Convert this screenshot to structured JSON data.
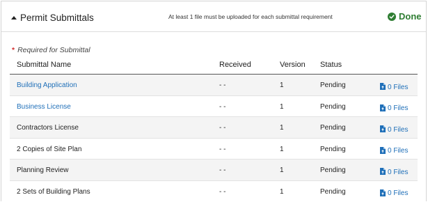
{
  "header": {
    "title": "Permit Submittals",
    "requirement_note": "At least 1 file must be uploaded for each submittal requirement",
    "status_label": "Done",
    "status_color": "#2e7d32"
  },
  "required_legend": {
    "star": "*",
    "text": "Required for Submittal"
  },
  "table": {
    "columns": [
      "Submittal Name",
      "Received",
      "Version",
      "Status"
    ],
    "rows": [
      {
        "name": "Building Application",
        "is_link": true,
        "received": "- -",
        "version": "1",
        "status": "Pending",
        "files": "0 Files"
      },
      {
        "name": "Business License",
        "is_link": true,
        "received": "- -",
        "version": "1",
        "status": "Pending",
        "files": "0 Files"
      },
      {
        "name": "Contractors License",
        "is_link": false,
        "received": "- -",
        "version": "1",
        "status": "Pending",
        "files": "0 Files"
      },
      {
        "name": "2 Copies of Site Plan",
        "is_link": false,
        "received": "- -",
        "version": "1",
        "status": "Pending",
        "files": "0 Files"
      },
      {
        "name": "Planning Review",
        "is_link": false,
        "received": "- -",
        "version": "1",
        "status": "Pending",
        "files": "0 Files"
      },
      {
        "name": "2 Sets of Building Plans",
        "is_link": false,
        "received": "- -",
        "version": "1",
        "status": "Pending",
        "files": "0 Files"
      }
    ]
  },
  "icons": {
    "collapse": "caret-up-icon",
    "done": "check-circle-icon",
    "files": "file-upload-icon"
  },
  "colors": {
    "link": "#1f6fb8",
    "required_star": "#d32f2f"
  }
}
